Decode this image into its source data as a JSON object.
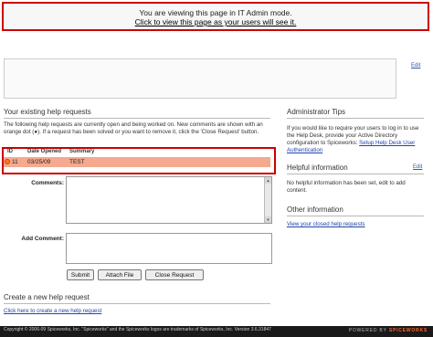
{
  "banner": {
    "line1": "You are viewing this page in IT Admin mode.",
    "line2": "Click to view this page as your users will see it."
  },
  "intro": {
    "edit_label": "Edit"
  },
  "help_requests": {
    "title": "Your existing help requests",
    "description": "The following help requests are currently open and being worked on. New comments are shown with an orange dot (●). If a request has been solved or you want to remove it, click the 'Close Request' button.",
    "columns": [
      "ID",
      "Date Opened",
      "Summary"
    ],
    "rows": [
      {
        "id": "11",
        "date_opened": "03/25/09",
        "summary": "TEST"
      }
    ]
  },
  "form": {
    "comments_label": "Comments:",
    "add_comment_label": "Add Comment:",
    "submit_label": "Submit",
    "attach_label": "Attach File",
    "close_label": "Close Request"
  },
  "create": {
    "title": "Create a new help request",
    "link": "Click here to create a new help request"
  },
  "sidebar": {
    "admin_tips_title": "Administrator Tips",
    "admin_tips_text": "If you would like to require your users to log in to use the Help Desk, provide your Active Directory configuration to Spiceworks:",
    "admin_tips_link": "Setup Help Desk User Authentication",
    "helpful_title": "Helpful information",
    "helpful_edit": "Edit",
    "helpful_text": "No helpful information has been set, edit to add content.",
    "other_title": "Other information",
    "other_link": "View your closed help requests"
  },
  "footer": {
    "copyright": "Copyright © 2006-09 Spiceworks, Inc. \"Spiceworks\" and the Spiceworks logos are trademarks of Spiceworks, Inc. Version 3.6.31847",
    "powered_prefix": "POWERED BY",
    "powered_brand": "SPICEWORKS"
  },
  "colors": {
    "highlight_border": "#cc0000",
    "row_background": "#f5a98e",
    "new_comment_dot": "#ff7a1a"
  }
}
